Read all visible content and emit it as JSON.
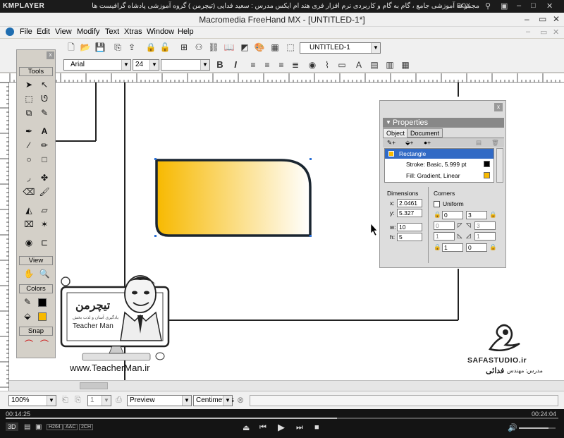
{
  "player": {
    "logo": "KMPLAYER",
    "title": "مجموعه آموزشی جامع ، گام به گام و کاربردی نرم افزار فری هند ام ایکس  مدرس : سعید فدایی (تیچرمن ) گروه آموزشی پادشاه گرافیست ها",
    "box_label": "BOX",
    "time_elapsed": "00:14:25",
    "time_total": "00:24:04",
    "badges": [
      "3D",
      "H264",
      "AAC",
      "2CH"
    ]
  },
  "window": {
    "title": "Macromedia FreeHand MX - [UNTITLED-1*]"
  },
  "menu": [
    "File",
    "Edit",
    "View",
    "Modify",
    "Text",
    "Xtras",
    "Window",
    "Help"
  ],
  "toolbar": {
    "document_select": "UNTITLED-1",
    "font_name": "Arial",
    "font_size": "24"
  },
  "tools": {
    "headers": {
      "tools": "Tools",
      "view": "View",
      "colors": "Colors",
      "snap": "Snap"
    },
    "close": "x"
  },
  "properties": {
    "title": "Properties",
    "close": "x",
    "tabs": [
      "Object",
      "Document"
    ],
    "object_name": "Rectangle",
    "stroke": "Stroke: Basic, 5.999 pt",
    "fill": "Fill: Gradient, Linear",
    "dimensions_label": "Dimensions",
    "corners_label": "Corners",
    "uniform_label": "Uniform",
    "x_label": "x:",
    "y_label": "y:",
    "w_label": "w:",
    "h_label": "h:",
    "x": "2.0461",
    "y": "5.327",
    "w": "10",
    "h": "5",
    "corner_values": [
      "0",
      "3",
      "0",
      "3",
      "1",
      "1",
      "1",
      "0"
    ]
  },
  "status": {
    "zoom": "100%",
    "page": "1",
    "view_mode": "Preview",
    "units": "Centimeters"
  },
  "watermark": {
    "logo_persian": "تیچرمن",
    "tagline_persian": "یادگیری آسان و لذت بخش",
    "brand": "Teacher Man",
    "website": "www.TeacherMan.ir",
    "studio": "SAFASTUDIO.ir",
    "instructor": "مدرس: مهندس",
    "instructor_name": "فدائی"
  },
  "colors": {
    "gradient_start": "#f7b900",
    "gradient_end": "#ffffff",
    "stroke": "#111111",
    "selected_row": "#316ac5"
  }
}
